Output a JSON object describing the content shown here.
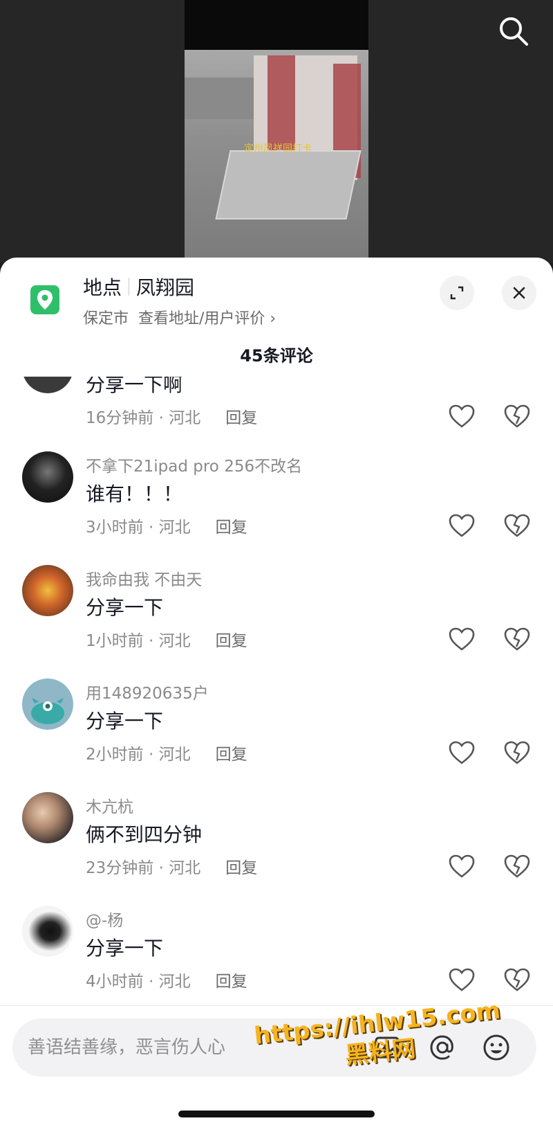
{
  "video": {
    "caption": "定州凤祥园打卡"
  },
  "header": {
    "search_icon": "search-icon"
  },
  "location": {
    "label": "地点",
    "name": "凤翔园",
    "city": "保定市",
    "link": "查看地址/用户评价 ›",
    "icon": "location-pin-icon",
    "accent": "#2fbf6b"
  },
  "comments_header": {
    "count_label": "45条评论"
  },
  "comments": [
    {
      "username": "",
      "text": "分享一下啊",
      "time": "16分钟前 · 河北",
      "reply": "回复"
    },
    {
      "username": "不拿下21ipad pro 256不改名",
      "text": "谁有！！！",
      "time": "3小时前 · 河北",
      "reply": "回复"
    },
    {
      "username": "我命由我 不由天",
      "text": "分享一下",
      "time": "1小时前 · 河北",
      "reply": "回复"
    },
    {
      "username": "用148920635户",
      "text": "分享一下",
      "time": "2小时前 · 河北",
      "reply": "回复"
    },
    {
      "username": "木亢杭",
      "text": "俩不到四分钟",
      "time": "23分钟前 · 河北",
      "reply": "回复"
    },
    {
      "username": "@-杨",
      "text": "分享一下",
      "time": "4小时前 · 河北",
      "reply": "回复"
    }
  ],
  "input": {
    "placeholder": "善语结善缘，恶言伤人心"
  },
  "watermark": {
    "url": "https://ihlw15.com",
    "name": "黑料网"
  }
}
